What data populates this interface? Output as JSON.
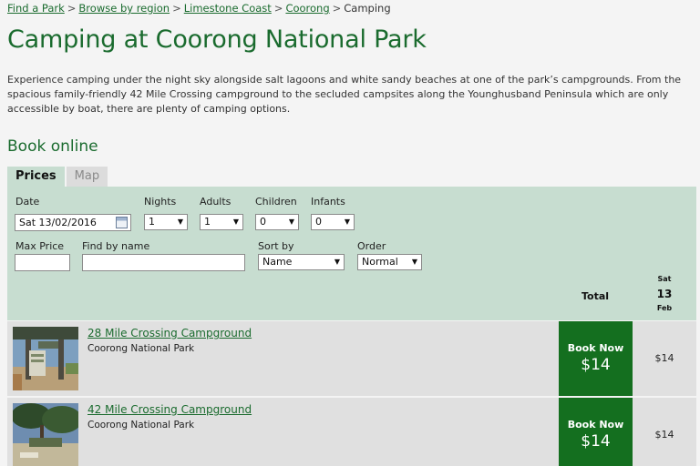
{
  "breadcrumb": {
    "items": [
      "Find a Park",
      "Browse by region",
      "Limestone Coast",
      "Coorong"
    ],
    "current": "Camping",
    "separator": ">"
  },
  "page_title": "Camping at Coorong National Park",
  "intro": "Experience camping under the night sky alongside salt lagoons and white sandy beaches at one of the park’s campgrounds. From the spacious family-friendly 42 Mile Crossing campground to the secluded campsites along the Younghusband Peninsula which are only accessible by boat, there are plenty of camping options.",
  "section_title": "Book online",
  "tabs": {
    "prices": "Prices",
    "map": "Map"
  },
  "filters": {
    "date_label": "Date",
    "date_value": "Sat 13/02/2016",
    "nights_label": "Nights",
    "nights_value": "1",
    "adults_label": "Adults",
    "adults_value": "1",
    "children_label": "Children",
    "children_value": "0",
    "infants_label": "Infants",
    "infants_value": "0",
    "maxprice_label": "Max Price",
    "maxprice_value": "",
    "findname_label": "Find by name",
    "findname_value": "",
    "sortby_label": "Sort by",
    "sortby_value": "Name",
    "order_label": "Order",
    "order_value": "Normal"
  },
  "columns": {
    "total": "Total",
    "day_name": "Sat",
    "day_num": "13",
    "month": "Feb"
  },
  "campgrounds": [
    {
      "name": "28 Mile Crossing Campground",
      "park": "Coorong National Park",
      "book_label": "Book Now",
      "total": "$14",
      "night_price": "$14"
    },
    {
      "name": "42 Mile Crossing Campground",
      "park": "Coorong National Park",
      "book_label": "Book Now",
      "total": "$14",
      "night_price": "$14"
    }
  ],
  "colors": {
    "accent": "#1a6b2e",
    "book_button": "#146f1f",
    "panel": "#c7ddd0",
    "row": "#e0e0e0"
  },
  "icons": {
    "calendar": "calendar-icon",
    "dropdown": "chevron-down-icon"
  }
}
